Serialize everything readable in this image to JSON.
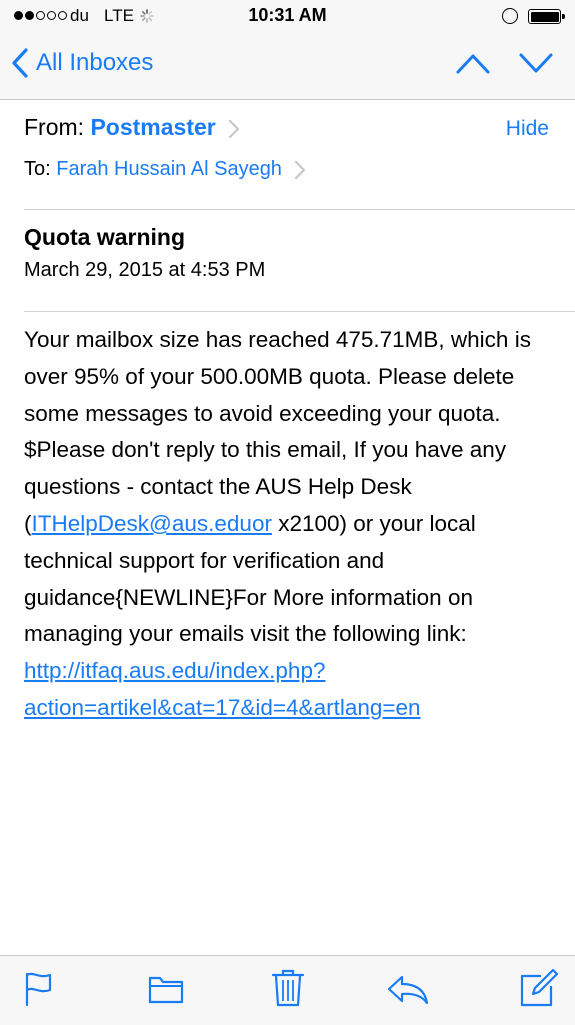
{
  "status_bar": {
    "carrier": "du",
    "network": "LTE",
    "time": "10:31 AM",
    "signal_bars_filled": 2,
    "signal_bars_total": 5
  },
  "nav": {
    "back_label": "All Inboxes"
  },
  "header": {
    "from_label": "From:",
    "from_name": "Postmaster",
    "hide_label": "Hide",
    "to_label": "To:",
    "to_name": "Farah Hussain Al Sayegh"
  },
  "message": {
    "subject": "Quota warning",
    "date": "March 29, 2015 at 4:53 PM",
    "body": {
      "intro": "Your mailbox size has reached 475.71MB, which is over 95% of your 500.00MB quota. Please delete some messages to avoid exceeding your quota.",
      "support_before": "$Please don't reply to this email, If you have any questions - contact the AUS Help Desk (",
      "support_email": "ITHelpDesk@aus.eduor",
      "support_after": " x2100) or your local technical support for verification and guidance{NEWLINE}For More information on managing your emails visit the following link: ",
      "link_line1": "http://itfaq.aus.edu/index.php?",
      "link_line2": "action=artikel&cat=17&id=4&artlang=en"
    }
  },
  "colors": {
    "accent": "#1a7cf5",
    "bar_background": "#f7f7f8",
    "divider": "#d1d1d6"
  },
  "toolbar_icons": [
    "flag-icon",
    "folder-icon",
    "trash-icon",
    "reply-icon",
    "compose-icon"
  ]
}
